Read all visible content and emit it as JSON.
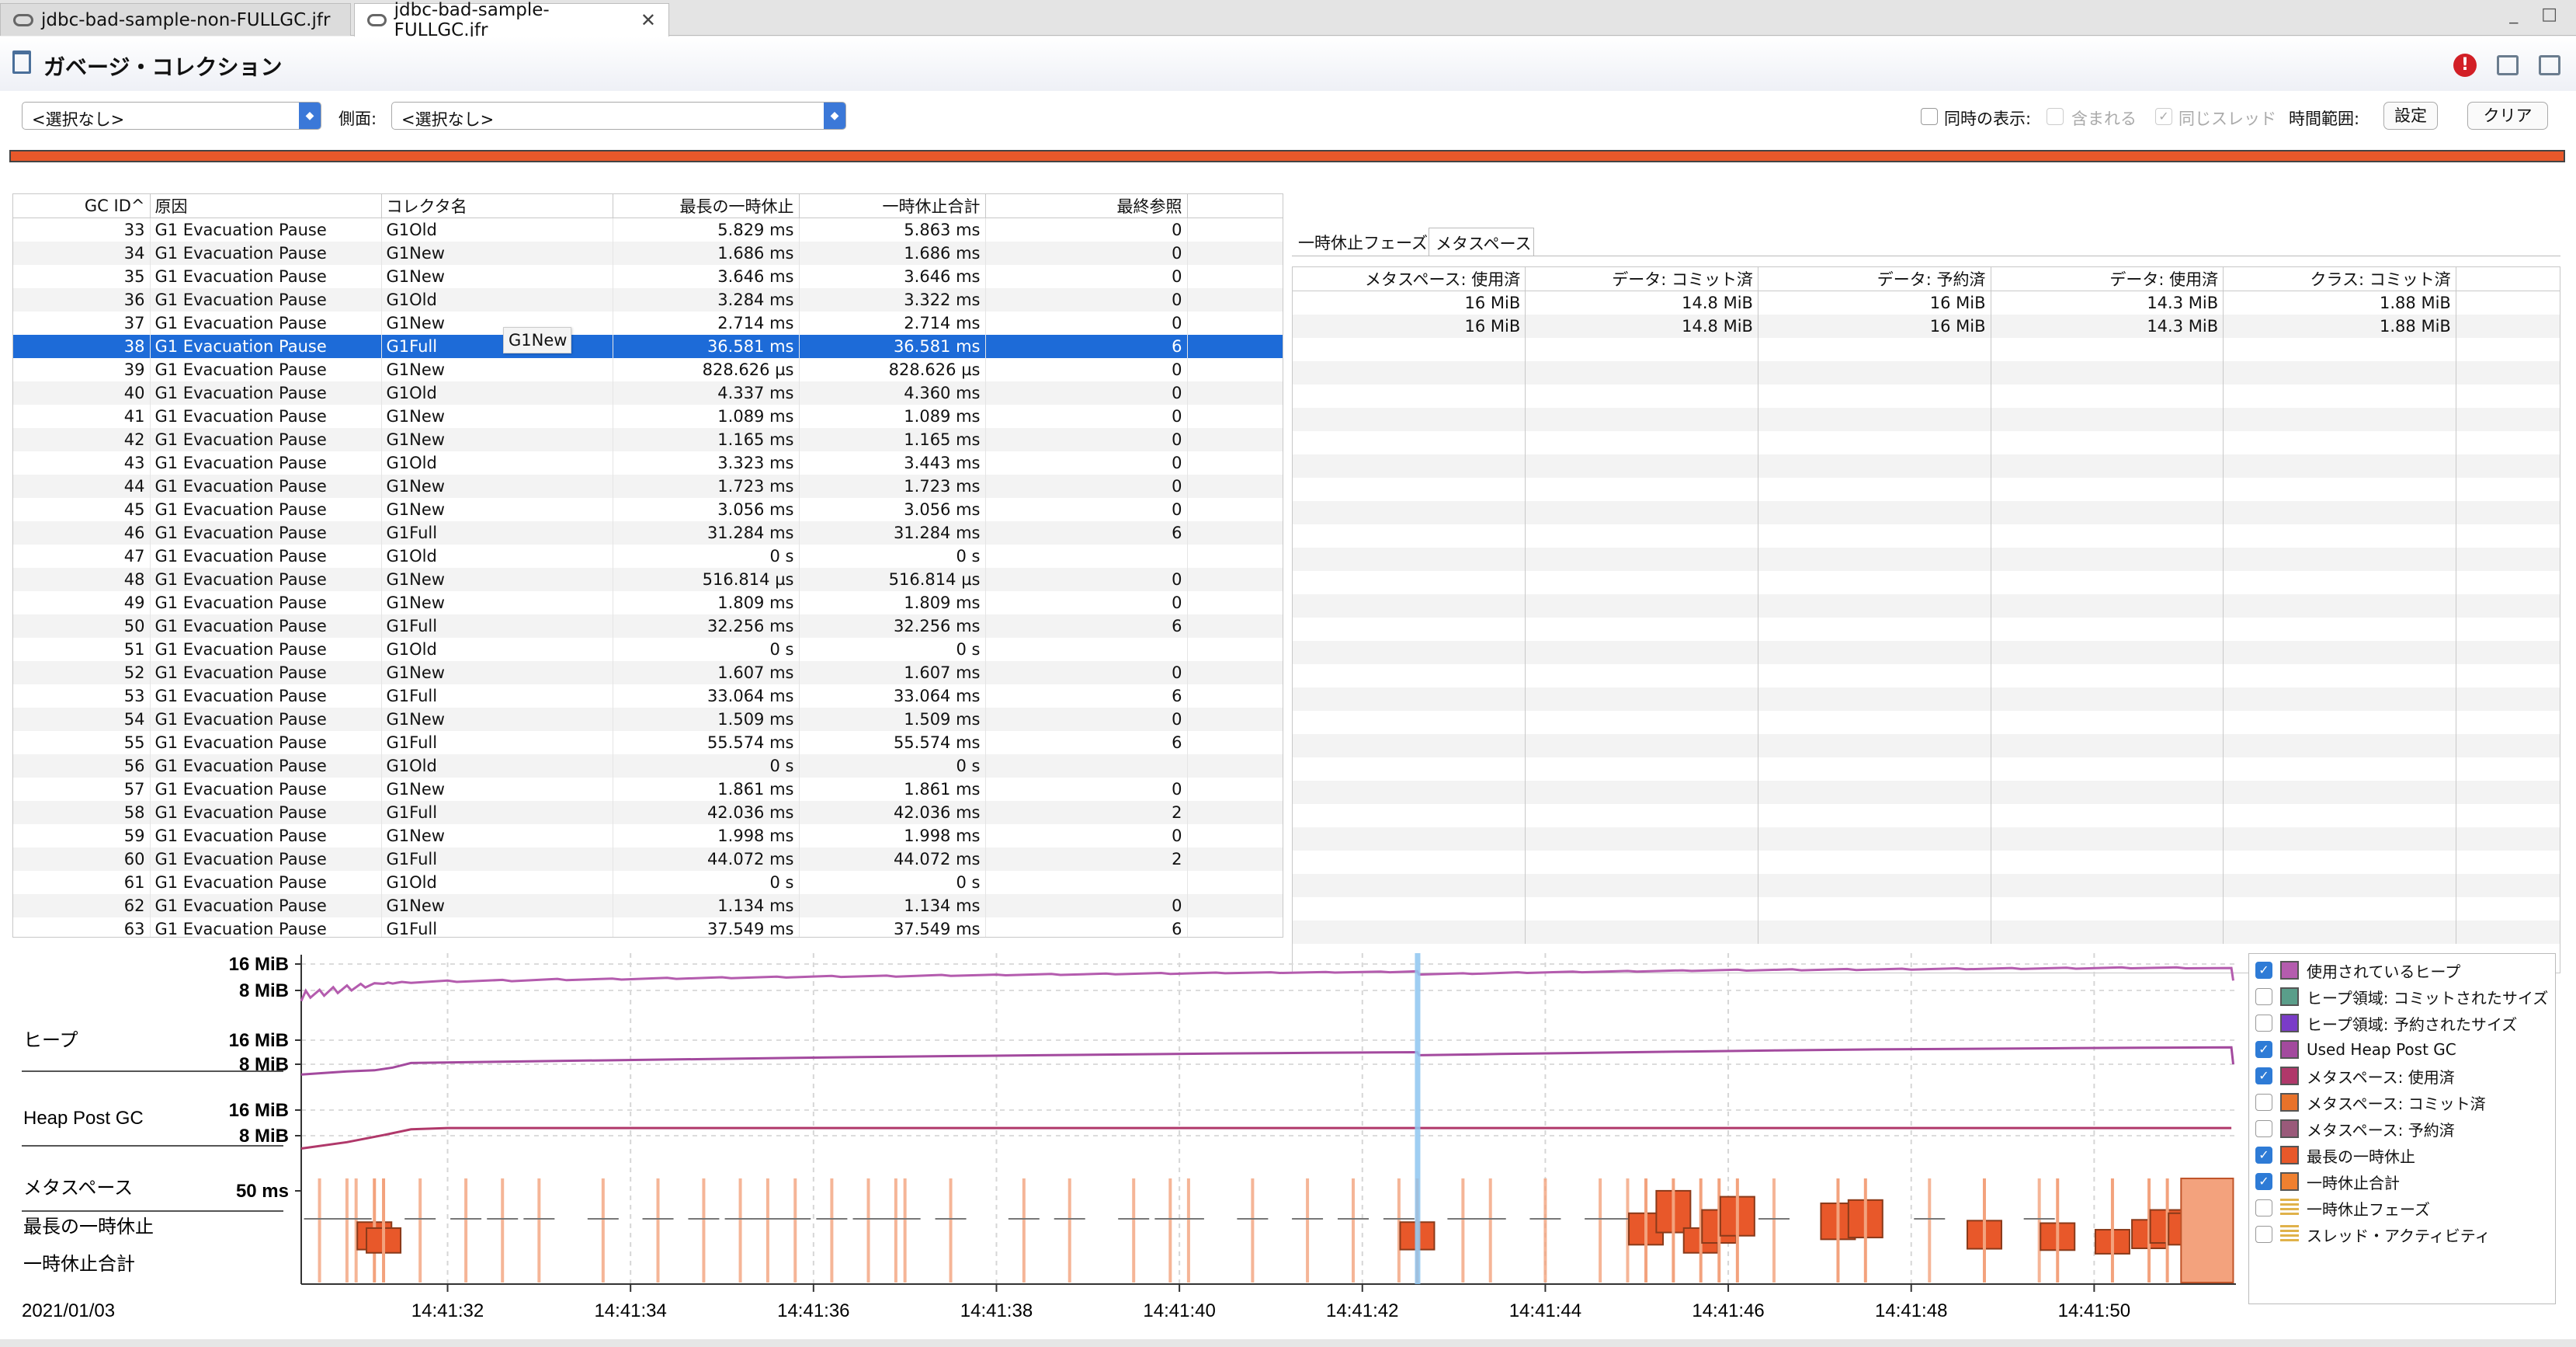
{
  "file_tabs": [
    {
      "label": "jdbc-bad-sample-non-FULLGC.jfr",
      "active": false
    },
    {
      "label": "jdbc-bad-sample-FULLGC.jfr",
      "active": true
    }
  ],
  "page": {
    "title": "ガベージ・コレクション"
  },
  "filter": {
    "combo1": "<選択なし>",
    "side_label": "側面:",
    "combo2": "<選択なし>",
    "simul_label": "同時の表示:",
    "contains_label": "含まれる",
    "same_thread_label": "同じスレッド",
    "time_range_label": "時間範囲:",
    "settings_button": "設定",
    "clear_button": "クリア"
  },
  "gc_table": {
    "columns": [
      "GC ID",
      "原因",
      "コレクタ名",
      "最長の一時休止",
      "一時休止合計",
      "最終参照"
    ],
    "sort_indicator": "^",
    "selected_id": "38",
    "rows": [
      [
        "33",
        "G1 Evacuation Pause",
        "G1Old",
        "5.829 ms",
        "5.863 ms",
        "0"
      ],
      [
        "34",
        "G1 Evacuation Pause",
        "G1New",
        "1.686 ms",
        "1.686 ms",
        "0"
      ],
      [
        "35",
        "G1 Evacuation Pause",
        "G1New",
        "3.646 ms",
        "3.646 ms",
        "0"
      ],
      [
        "36",
        "G1 Evacuation Pause",
        "G1Old",
        "3.284 ms",
        "3.322 ms",
        "0"
      ],
      [
        "37",
        "G1 Evacuation Pause",
        "G1New",
        "2.714 ms",
        "2.714 ms",
        "0"
      ],
      [
        "38",
        "G1 Evacuation Pause",
        "G1Full",
        "36.581 ms",
        "36.581 ms",
        "6"
      ],
      [
        "39",
        "G1 Evacuation Pause",
        "G1New",
        "828.626 µs",
        "828.626 µs",
        "0"
      ],
      [
        "40",
        "G1 Evacuation Pause",
        "G1Old",
        "4.337 ms",
        "4.360 ms",
        "0"
      ],
      [
        "41",
        "G1 Evacuation Pause",
        "G1New",
        "1.089 ms",
        "1.089 ms",
        "0"
      ],
      [
        "42",
        "G1 Evacuation Pause",
        "G1New",
        "1.165 ms",
        "1.165 ms",
        "0"
      ],
      [
        "43",
        "G1 Evacuation Pause",
        "G1Old",
        "3.323 ms",
        "3.443 ms",
        "0"
      ],
      [
        "44",
        "G1 Evacuation Pause",
        "G1New",
        "1.723 ms",
        "1.723 ms",
        "0"
      ],
      [
        "45",
        "G1 Evacuation Pause",
        "G1New",
        "3.056 ms",
        "3.056 ms",
        "0"
      ],
      [
        "46",
        "G1 Evacuation Pause",
        "G1Full",
        "31.284 ms",
        "31.284 ms",
        "6"
      ],
      [
        "47",
        "G1 Evacuation Pause",
        "G1Old",
        "0 s",
        "0 s",
        ""
      ],
      [
        "48",
        "G1 Evacuation Pause",
        "G1New",
        "516.814 µs",
        "516.814 µs",
        "0"
      ],
      [
        "49",
        "G1 Evacuation Pause",
        "G1New",
        "1.809 ms",
        "1.809 ms",
        "0"
      ],
      [
        "50",
        "G1 Evacuation Pause",
        "G1Full",
        "32.256 ms",
        "32.256 ms",
        "6"
      ],
      [
        "51",
        "G1 Evacuation Pause",
        "G1Old",
        "0 s",
        "0 s",
        ""
      ],
      [
        "52",
        "G1 Evacuation Pause",
        "G1New",
        "1.607 ms",
        "1.607 ms",
        "0"
      ],
      [
        "53",
        "G1 Evacuation Pause",
        "G1Full",
        "33.064 ms",
        "33.064 ms",
        "6"
      ],
      [
        "54",
        "G1 Evacuation Pause",
        "G1New",
        "1.509 ms",
        "1.509 ms",
        "0"
      ],
      [
        "55",
        "G1 Evacuation Pause",
        "G1Full",
        "55.574 ms",
        "55.574 ms",
        "6"
      ],
      [
        "56",
        "G1 Evacuation Pause",
        "G1Old",
        "0 s",
        "0 s",
        ""
      ],
      [
        "57",
        "G1 Evacuation Pause",
        "G1New",
        "1.861 ms",
        "1.861 ms",
        "0"
      ],
      [
        "58",
        "G1 Evacuation Pause",
        "G1Full",
        "42.036 ms",
        "42.036 ms",
        "2"
      ],
      [
        "59",
        "G1 Evacuation Pause",
        "G1New",
        "1.998 ms",
        "1.998 ms",
        "0"
      ],
      [
        "60",
        "G1 Evacuation Pause",
        "G1Full",
        "44.072 ms",
        "44.072 ms",
        "2"
      ],
      [
        "61",
        "G1 Evacuation Pause",
        "G1Old",
        "0 s",
        "0 s",
        ""
      ],
      [
        "62",
        "G1 Evacuation Pause",
        "G1New",
        "1.134 ms",
        "1.134 ms",
        "0"
      ],
      [
        "63",
        "G1 Evacuation Pause",
        "G1Full",
        "37.549 ms",
        "37.549 ms",
        "6"
      ]
    ]
  },
  "tooltip": "G1New",
  "right_tabs": [
    "一時休止フェーズ",
    "メタスペース"
  ],
  "right_tab_active": "メタスペース",
  "metaspace_table": {
    "columns": [
      "メタスペース: 使用済",
      "データ: コミット済",
      "データ: 予約済",
      "データ: 使用済",
      "クラス: コミット済"
    ],
    "rows": [
      [
        "16 MiB",
        "14.8 MiB",
        "16 MiB",
        "14.3 MiB",
        "1.88 MiB"
      ],
      [
        "16 MiB",
        "14.8 MiB",
        "16 MiB",
        "14.3 MiB",
        "1.88 MiB"
      ]
    ]
  },
  "chart_data": {
    "type": "line",
    "x_ticks": [
      "14:41:32",
      "14:41:34",
      "14:41:36",
      "14:41:38",
      "14:41:40",
      "14:41:42",
      "14:41:44",
      "14:41:46",
      "14:41:48",
      "14:41:50"
    ],
    "date_label": "2021/01/03",
    "lanes": [
      {
        "label": "ヒープ",
        "ticks": [
          "16 MiB",
          "8 MiB"
        ]
      },
      {
        "label": "Heap Post GC",
        "ticks": [
          "16 MiB",
          "8 MiB"
        ]
      },
      {
        "label": "メタスペース",
        "ticks": [
          "16 MiB",
          "8 MiB"
        ]
      },
      {
        "label": "最長の一時休止",
        "ticks": [
          "50 ms"
        ]
      },
      {
        "label": "一時休止合計",
        "ticks": []
      }
    ],
    "selection_time": "14:41:42.6",
    "colors": {
      "heap": "#b45cae",
      "post_gc": "#a34a9e",
      "metaspace": "#b0386a",
      "pause": "#e8582a",
      "pause_fill": "#f3a27d",
      "selection": "#8ec6f0"
    },
    "series": [
      {
        "name": "使用されているヒープ",
        "lane": 0,
        "unit": "MiB",
        "points": [
          [
            30.4,
            4.8
          ],
          [
            30.45,
            7.9
          ],
          [
            30.5,
            5.8
          ],
          [
            30.6,
            8.2
          ],
          [
            30.65,
            6.4
          ],
          [
            30.75,
            9.0
          ],
          [
            30.8,
            7.2
          ],
          [
            30.9,
            9.5
          ],
          [
            30.95,
            8.0
          ],
          [
            31.05,
            10.0
          ],
          [
            31.1,
            8.9
          ],
          [
            31.2,
            10.2
          ],
          [
            31.3,
            10.0
          ],
          [
            31.35,
            10.4
          ],
          [
            31.4,
            10.1
          ],
          [
            31.5,
            10.6
          ],
          [
            31.6,
            10.3
          ],
          [
            32.0,
            11.0
          ],
          [
            32.1,
            10.6
          ],
          [
            32.6,
            11.2
          ],
          [
            32.7,
            10.8
          ],
          [
            33.2,
            11.5
          ],
          [
            33.3,
            11.1
          ],
          [
            33.8,
            11.6
          ],
          [
            33.9,
            11.3
          ],
          [
            34.4,
            11.8
          ],
          [
            34.5,
            11.5
          ],
          [
            35.0,
            12.0
          ],
          [
            35.1,
            11.7
          ],
          [
            35.6,
            12.2
          ],
          [
            35.7,
            11.9
          ],
          [
            36.2,
            12.4
          ],
          [
            36.3,
            12.1
          ],
          [
            36.8,
            12.5
          ],
          [
            36.9,
            12.2
          ],
          [
            37.4,
            12.7
          ],
          [
            37.5,
            12.4
          ],
          [
            38.0,
            12.8
          ],
          [
            38.1,
            12.6
          ],
          [
            38.6,
            13.0
          ],
          [
            38.7,
            12.7
          ],
          [
            39.2,
            13.1
          ],
          [
            39.3,
            12.9
          ],
          [
            39.8,
            13.3
          ],
          [
            39.9,
            13.0
          ],
          [
            40.4,
            13.4
          ],
          [
            40.5,
            13.2
          ],
          [
            41.0,
            13.5
          ],
          [
            41.1,
            13.3
          ],
          [
            41.6,
            13.6
          ],
          [
            41.7,
            13.4
          ],
          [
            42.2,
            13.7
          ],
          [
            42.3,
            13.5
          ],
          [
            42.6,
            13.8
          ],
          [
            42.62,
            12.8
          ],
          [
            43.1,
            13.2
          ],
          [
            43.2,
            13.0
          ],
          [
            43.7,
            13.5
          ],
          [
            43.8,
            13.3
          ],
          [
            44.3,
            13.7
          ],
          [
            44.4,
            13.5
          ],
          [
            44.9,
            13.9
          ],
          [
            45.0,
            13.7
          ],
          [
            45.5,
            14.1
          ],
          [
            45.6,
            13.9
          ],
          [
            46.1,
            14.3
          ],
          [
            46.2,
            14.0
          ],
          [
            46.7,
            14.4
          ],
          [
            46.8,
            14.1
          ],
          [
            47.3,
            14.5
          ],
          [
            47.4,
            14.2
          ],
          [
            47.9,
            14.6
          ],
          [
            48.0,
            14.3
          ],
          [
            48.5,
            14.7
          ],
          [
            48.6,
            14.4
          ],
          [
            49.1,
            14.8
          ],
          [
            49.2,
            14.5
          ],
          [
            49.7,
            14.9
          ],
          [
            49.8,
            14.6
          ],
          [
            50.3,
            15.0
          ],
          [
            50.4,
            14.7
          ],
          [
            50.9,
            15.0
          ],
          [
            51.0,
            14.7
          ],
          [
            51.5,
            14.8
          ],
          [
            51.52,
            11.0
          ]
        ]
      },
      {
        "name": "Used Heap Post GC",
        "lane": 1,
        "unit": "MiB",
        "points": [
          [
            30.4,
            4.6
          ],
          [
            30.9,
            5.6
          ],
          [
            31.2,
            6.0
          ],
          [
            31.4,
            6.9
          ],
          [
            31.6,
            8.4
          ],
          [
            32.5,
            8.8
          ],
          [
            33.5,
            9.2
          ],
          [
            34.5,
            9.6
          ],
          [
            35.5,
            10.0
          ],
          [
            36.5,
            10.4
          ],
          [
            37.5,
            10.7
          ],
          [
            38.5,
            11.0
          ],
          [
            39.5,
            11.3
          ],
          [
            40.5,
            11.6
          ],
          [
            41.5,
            11.8
          ],
          [
            42.6,
            12.0
          ],
          [
            42.62,
            11.0
          ],
          [
            43.5,
            11.4
          ],
          [
            44.5,
            11.8
          ],
          [
            45.5,
            12.2
          ],
          [
            46.5,
            12.6
          ],
          [
            47.5,
            12.9
          ],
          [
            48.5,
            13.1
          ],
          [
            49.5,
            13.3
          ],
          [
            50.5,
            13.5
          ],
          [
            51.5,
            13.6
          ],
          [
            51.52,
            8.0
          ]
        ]
      },
      {
        "name": "メタスペース: 使用済",
        "lane": 2,
        "unit": "MiB",
        "points": [
          [
            30.4,
            4.0
          ],
          [
            30.9,
            6.0
          ],
          [
            31.3,
            8.2
          ],
          [
            31.6,
            10.0
          ],
          [
            32.0,
            10.4
          ],
          [
            51.5,
            10.4
          ]
        ]
      }
    ],
    "pauses_ms": [
      [
        30.6,
        4
      ],
      [
        30.9,
        5
      ],
      [
        31.0,
        3
      ],
      [
        31.2,
        36.6
      ],
      [
        31.3,
        33
      ],
      [
        31.7,
        5
      ],
      [
        32.2,
        3
      ],
      [
        32.6,
        4
      ],
      [
        33.0,
        3
      ],
      [
        33.7,
        4
      ],
      [
        34.3,
        2
      ],
      [
        34.8,
        3
      ],
      [
        35.2,
        5
      ],
      [
        35.5,
        4
      ],
      [
        35.8,
        8
      ],
      [
        36.2,
        3
      ],
      [
        36.6,
        2
      ],
      [
        36.9,
        3
      ],
      [
        37.0,
        4
      ],
      [
        37.5,
        3
      ],
      [
        38.3,
        5
      ],
      [
        38.8,
        4
      ],
      [
        39.5,
        3
      ],
      [
        39.9,
        3
      ],
      [
        40.1,
        4
      ],
      [
        40.8,
        3
      ],
      [
        41.4,
        4
      ],
      [
        41.9,
        3
      ],
      [
        42.4,
        3
      ],
      [
        42.6,
        36.6
      ],
      [
        43.1,
        5
      ],
      [
        43.4,
        3
      ],
      [
        44.0,
        4
      ],
      [
        44.6,
        3
      ],
      [
        44.9,
        4
      ],
      [
        45.1,
        42
      ],
      [
        45.4,
        55.6
      ],
      [
        45.7,
        33
      ],
      [
        45.9,
        44
      ],
      [
        46.1,
        52
      ],
      [
        46.5,
        5
      ],
      [
        47.2,
        48
      ],
      [
        47.5,
        50
      ],
      [
        48.2,
        3
      ],
      [
        48.8,
        37.5
      ],
      [
        49.4,
        5
      ],
      [
        49.6,
        36
      ],
      [
        50.2,
        32
      ],
      [
        50.6,
        38
      ],
      [
        50.8,
        44
      ],
      [
        51.0,
        42
      ],
      [
        51.3,
        40
      ]
    ]
  },
  "legend": [
    {
      "label": "使用されているヒープ",
      "checked": true,
      "color": "#b45cae"
    },
    {
      "label": "ヒープ領域: コミットされたサイズ",
      "checked": false,
      "color": "#5a9e8a"
    },
    {
      "label": "ヒープ領域: 予約されたサイズ",
      "checked": false,
      "color": "#7a3cc8"
    },
    {
      "label": "Used Heap Post GC",
      "checked": true,
      "color": "#a34a9e"
    },
    {
      "label": "メタスペース: 使用済",
      "checked": true,
      "color": "#b0386a"
    },
    {
      "label": "メタスペース: コミット済",
      "checked": false,
      "color": "#e8722a"
    },
    {
      "label": "メタスペース: 予約済",
      "checked": false,
      "color": "#9a5a7a"
    },
    {
      "label": "最長の一時休止",
      "checked": true,
      "color": "#e8582a"
    },
    {
      "label": "一時休止合計",
      "checked": true,
      "color": "#f08030"
    },
    {
      "label": "一時休止フェーズ",
      "checked": false,
      "color": "#e0b24a"
    },
    {
      "label": "スレッド・アクティビティ",
      "checked": false,
      "color": "#e0b24a"
    }
  ],
  "window_buttons": [
    "_",
    "□"
  ]
}
